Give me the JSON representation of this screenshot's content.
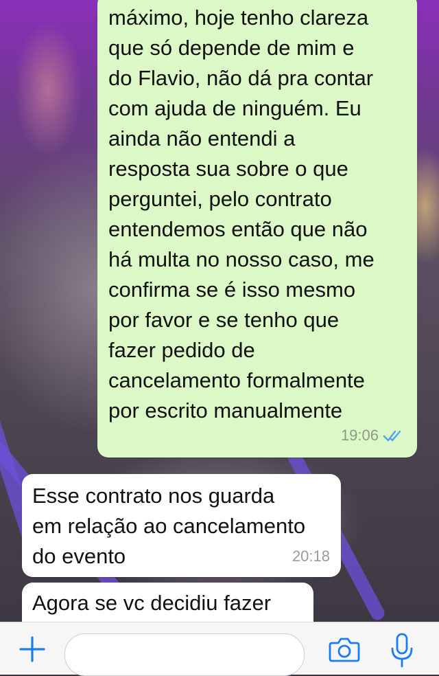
{
  "chat": {
    "messages": [
      {
        "direction": "outgoing",
        "text": "máximo, hoje tenho clareza\nque só depende de mim e\ndo Flavio, não dá pra contar\ncom ajuda de ninguém. Eu\nainda não entendi a\nresposta sua sobre o que\nperguntei, pelo contrato\nentendemos então que não\nhá multa no nosso caso, me\nconfirma se é isso mesmo\npor favor e se tenho que\nfazer pedido de\ncancelamento formalmente\npor escrito manualmente",
        "time": "19:06",
        "status": "read"
      },
      {
        "direction": "incoming",
        "text": "Esse contrato nos guarda\nem relação ao cancelamento\ndo evento",
        "time": "20:18"
      },
      {
        "direction": "incoming",
        "text": "Agora se vc decidiu fazer"
      }
    ]
  },
  "input_bar": {
    "placeholder": "",
    "icons": [
      "plus-icon",
      "camera-icon",
      "microphone-icon"
    ],
    "accent_color": "#1a7cf5"
  },
  "colors": {
    "outgoing_bubble": "#dcf8c6",
    "incoming_bubble": "#ffffff",
    "read_ticks": "#4fa3f7"
  }
}
